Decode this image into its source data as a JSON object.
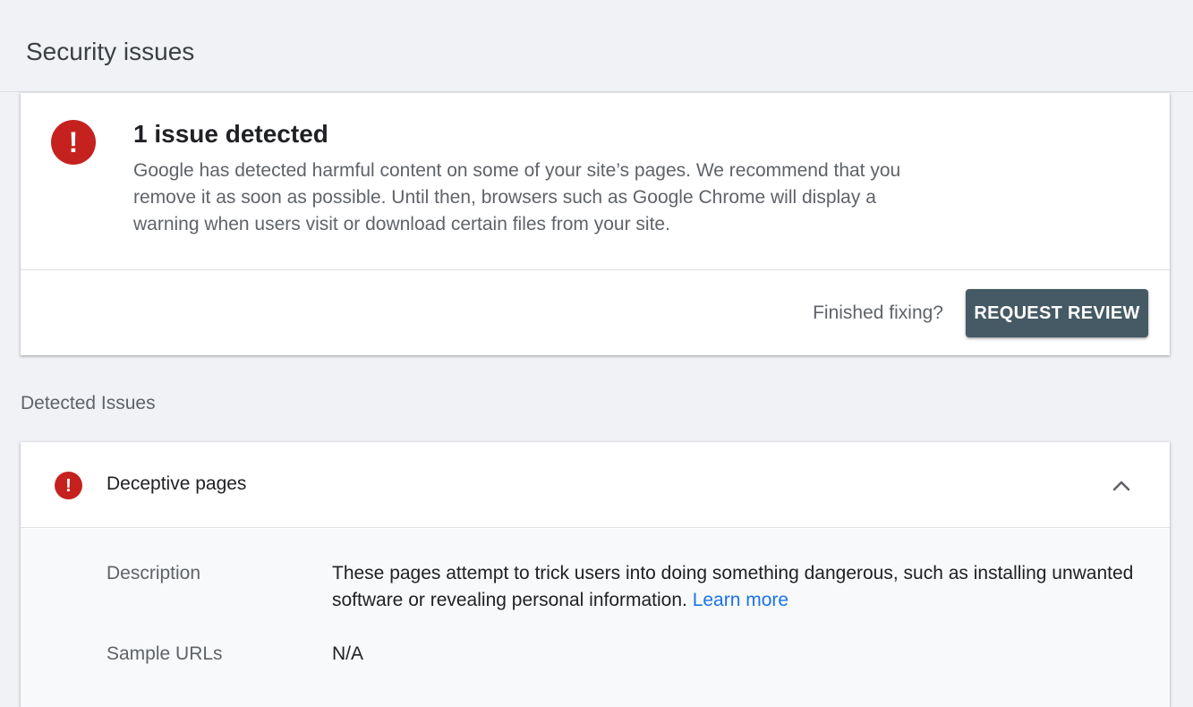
{
  "page": {
    "title": "Security issues"
  },
  "summary": {
    "icon": "error-icon",
    "icon_glyph": "!",
    "title": "1 issue detected",
    "description": "Google has detected harmful content on some of your site’s pages. We recommend that you remove it as soon as possible. Until then, browsers such as Google Chrome will display a warning when users visit or download certain files from your site.",
    "finished_prompt": "Finished fixing?",
    "request_review_label": "REQUEST REVIEW"
  },
  "detected": {
    "section_label": "Detected Issues",
    "issues": [
      {
        "icon": "error-icon",
        "icon_glyph": "!",
        "title": "Deceptive pages",
        "expanded": true,
        "description_label": "Description",
        "description_text": "These pages attempt to trick users into doing something dangerous, such as installing unwanted software or revealing personal information. ",
        "learn_more_label": "Learn more",
        "sample_urls_label": "Sample URLs",
        "sample_urls_value": "N/A"
      }
    ]
  },
  "colors": {
    "error_red": "#c5221f",
    "button_bg": "#455a64",
    "link_blue": "#1a73e8",
    "page_bg": "#f0f2f6"
  }
}
